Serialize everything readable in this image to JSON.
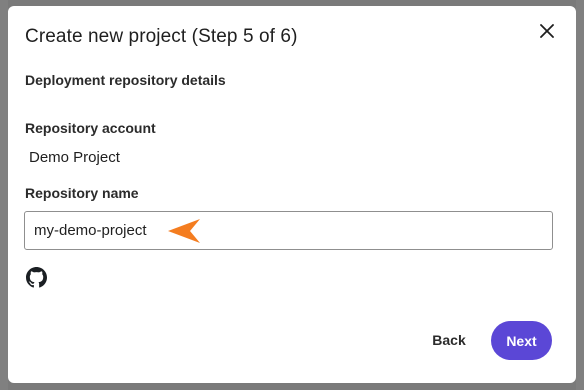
{
  "dialog": {
    "title": "Create new project (Step 5 of 6)",
    "section_heading": "Deployment repository details",
    "repository_account_label": "Repository account",
    "repository_account_value": "Demo Project",
    "repository_name_label": "Repository name",
    "repository_name_value": "my-demo-project",
    "back_label": "Back",
    "next_label": "Next"
  },
  "icons": {
    "close": "close-icon",
    "github": "github-icon",
    "pointer": "pointer-arrow-icon"
  },
  "colors": {
    "primary": "#5b47d6",
    "pointer_arrow": "#f47d20",
    "backdrop": "#7a7a7a"
  }
}
